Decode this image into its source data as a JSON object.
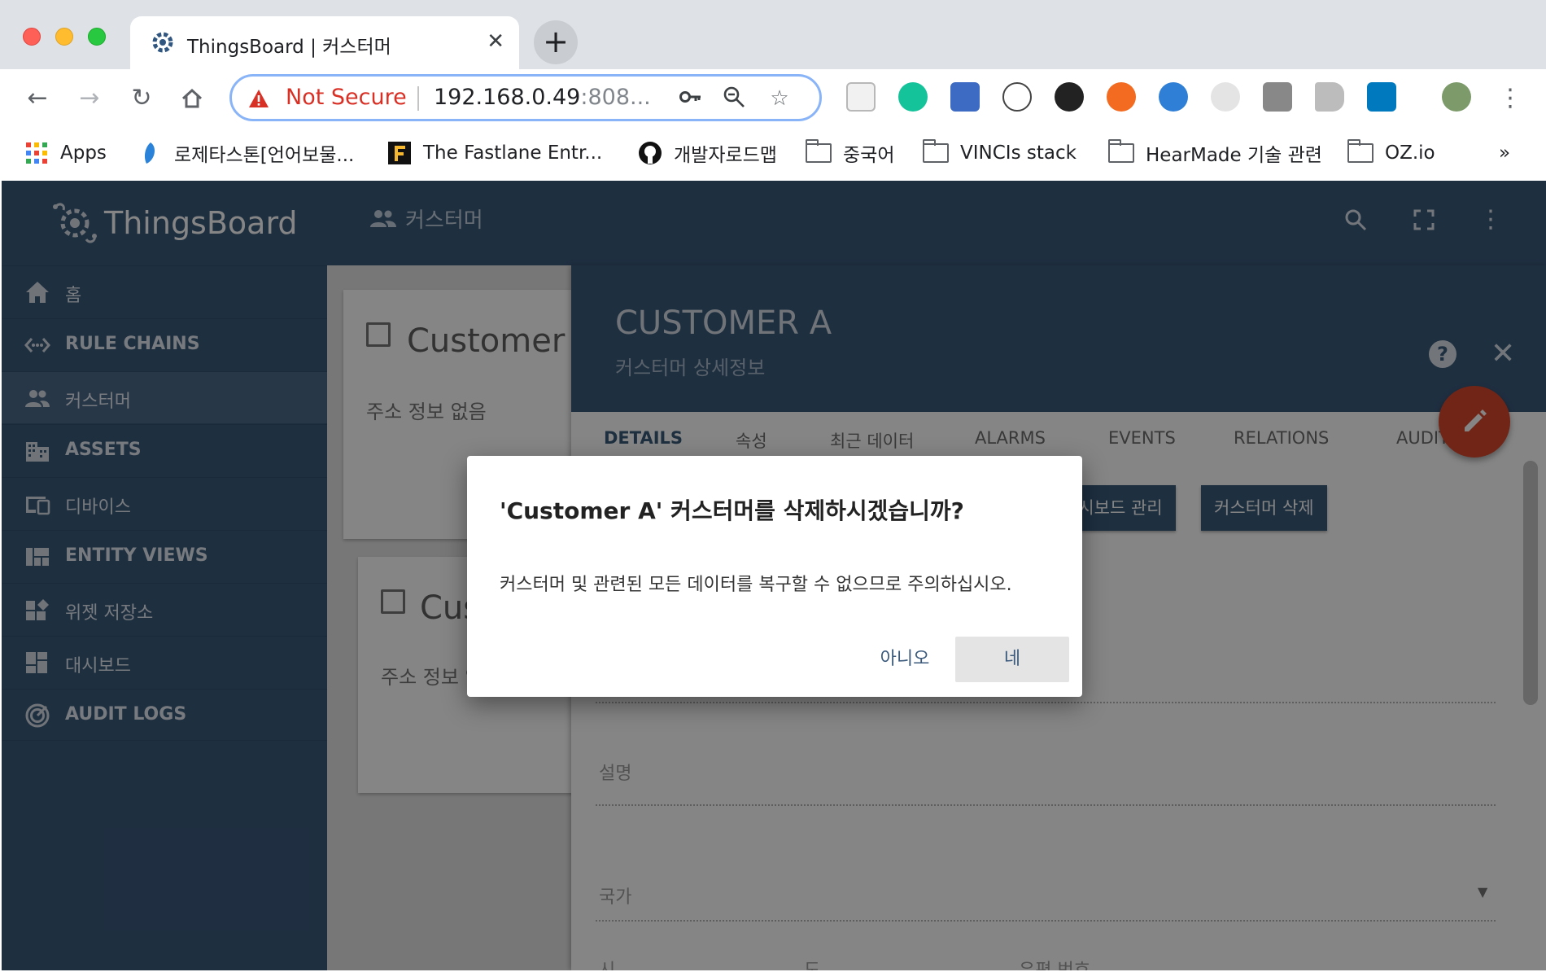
{
  "browser": {
    "tab_title": "ThingsBoard | 커스터머",
    "new_tab": "+",
    "tab_close": "✕",
    "security_label": "Not Secure",
    "url_host": "192.168.0.49",
    "url_rest": ":808...",
    "bookmarks": [
      {
        "label": "Apps",
        "icon": "apps-grid-icon"
      },
      {
        "label": "로제타스톤[언어보물...",
        "icon": "rosetta-icon"
      },
      {
        "label": "The Fastlane Entr...",
        "icon": "fastlane-icon"
      },
      {
        "label": "개발자로드맵",
        "icon": "github-icon"
      },
      {
        "label": "중국어",
        "icon": "folder-icon"
      },
      {
        "label": "VINCIs stack",
        "icon": "folder-icon"
      },
      {
        "label": "HearMade 기술 관련",
        "icon": "folder-icon"
      },
      {
        "label": "OZ.io",
        "icon": "folder-icon"
      }
    ],
    "more_bookmarks": "»"
  },
  "sidebar": {
    "brand": "ThingsBoard",
    "items": [
      {
        "label": "홈",
        "icon": "home-icon"
      },
      {
        "label": "RULE CHAINS",
        "icon": "rule-chains-icon"
      },
      {
        "label": "커스터머",
        "icon": "people-icon"
      },
      {
        "label": "ASSETS",
        "icon": "domain-icon"
      },
      {
        "label": "디바이스",
        "icon": "devices-icon"
      },
      {
        "label": "ENTITY VIEWS",
        "icon": "view-quilt-icon"
      },
      {
        "label": "위젯 저장소",
        "icon": "widgets-icon"
      },
      {
        "label": "대시보드",
        "icon": "dashboard-icon"
      },
      {
        "label": "AUDIT LOGS",
        "icon": "track-changes-icon"
      }
    ]
  },
  "topbar": {
    "title": "커스터머"
  },
  "cards": [
    {
      "title": "Customer A",
      "address": "주소 정보 없음"
    },
    {
      "title": "Customer",
      "address": "주소 정보 없음"
    }
  ],
  "detail": {
    "title": "CUSTOMER A",
    "subtitle": "커스터머 상세정보",
    "help": "?",
    "close": "✕",
    "tabs": [
      "DETAILS",
      "속성",
      "최근 데이터",
      "ALARMS",
      "EVENTS",
      "RELATIONS",
      "AUDIT LOGS"
    ],
    "actions": [
      "대시보드 관리",
      "커스터머 삭제"
    ],
    "fields": [
      "설명",
      "국가",
      "시",
      "도",
      "우편 번호"
    ]
  },
  "dialog": {
    "title": "'Customer A' 커스터머를 삭제하시겠습니까?",
    "body": "커스터머 및 관련된 모든 데이터를 복구할 수 없으므로 주의하십시오.",
    "cancel": "아니오",
    "confirm": "네"
  },
  "colors": {
    "primary": "#3b5a7c",
    "fab": "#d9472b",
    "insecure": "#d93025"
  }
}
